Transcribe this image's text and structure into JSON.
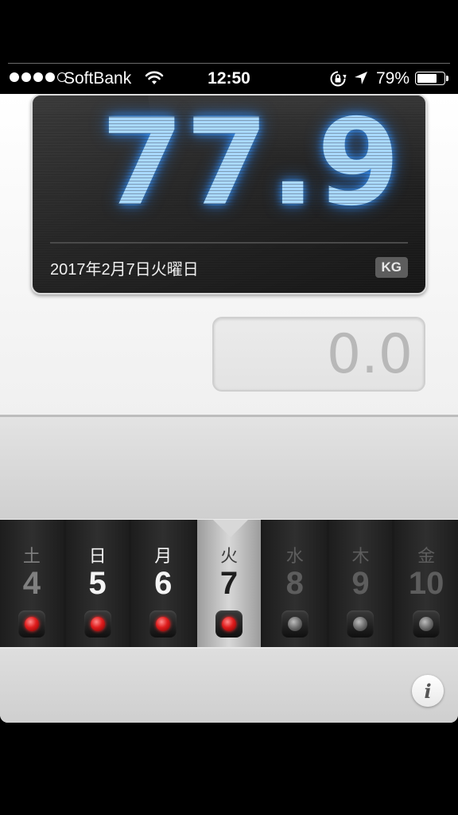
{
  "status_bar": {
    "carrier": "SoftBank",
    "time": "12:50",
    "battery_percent": "79%",
    "battery_level": 0.79,
    "signal_bars_filled": 4,
    "signal_bars_total": 5
  },
  "weight_display": {
    "value": "77.9",
    "date": "2017年2月7日火曜日",
    "unit": "KG"
  },
  "difference": {
    "value": "0.0"
  },
  "calendar": {
    "days": [
      {
        "weekday": "土",
        "date": "4",
        "recorded": true
      },
      {
        "weekday": "日",
        "date": "5",
        "recorded": true
      },
      {
        "weekday": "月",
        "date": "6",
        "recorded": true
      },
      {
        "weekday": "火",
        "date": "7",
        "recorded": true,
        "selected": true
      },
      {
        "weekday": "水",
        "date": "8",
        "recorded": false
      },
      {
        "weekday": "木",
        "date": "9",
        "recorded": false
      },
      {
        "weekday": "金",
        "date": "10",
        "recorded": false
      }
    ]
  },
  "info_button": {
    "label": "i"
  },
  "colors": {
    "lcd_digits": "#a9d9ff",
    "led_on": "#e01e1e",
    "led_off": "#6d6d6d"
  }
}
